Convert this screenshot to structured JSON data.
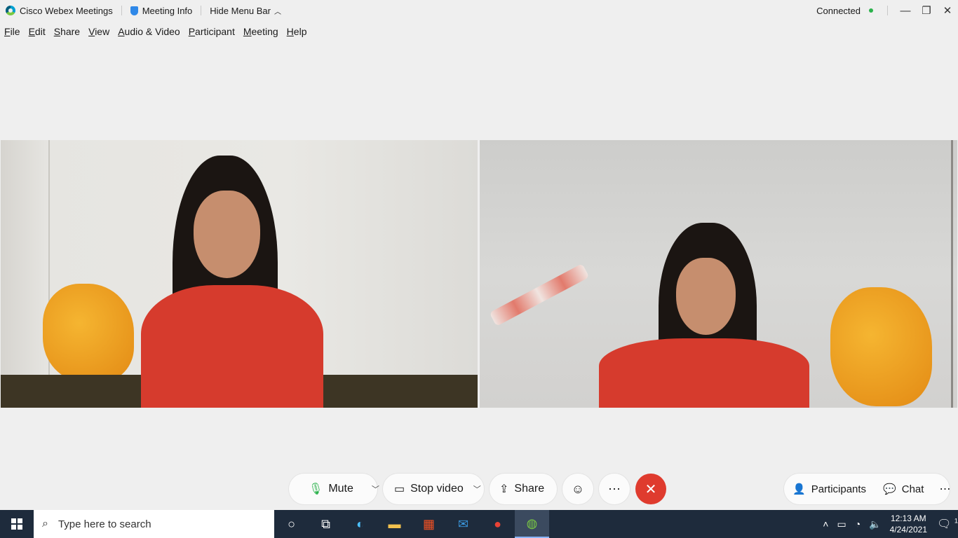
{
  "titlebar": {
    "app_title": "Cisco Webex Meetings",
    "meeting_info": "Meeting Info",
    "hide_menu_bar": "Hide Menu Bar",
    "status": "Connected",
    "minimize": "—",
    "restore": "❐",
    "close": "✕"
  },
  "menu": [
    "File",
    "Edit",
    "Share",
    "View",
    "Audio & Video",
    "Participant",
    "Meeting",
    "Help"
  ],
  "controls": {
    "mute": "Mute",
    "stop_video": "Stop video",
    "share": "Share",
    "participants": "Participants",
    "chat": "Chat"
  },
  "taskbar": {
    "search_placeholder": "Type here to search",
    "time": "12:13 AM",
    "date": "4/24/2021",
    "notification_count": "1"
  },
  "colors": {
    "end_call": "#df3b2e",
    "connected": "#2bb24c",
    "taskbar": "#1e2b3c"
  }
}
